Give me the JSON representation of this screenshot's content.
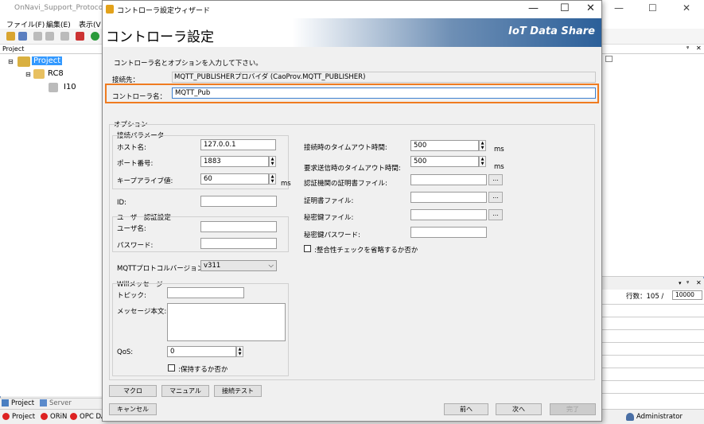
{
  "bg": {
    "title": "OnNavi_Support_Protocol_M",
    "menus": [
      "ファイル(F)",
      "編集(E)",
      "表示(V"
    ],
    "project_header": "Project",
    "tree": {
      "root": "Project",
      "child": "RC8",
      "leaf": "I10"
    },
    "bottom_tabs": [
      "Project",
      "Server"
    ],
    "status_items": [
      "Project",
      "ORiN",
      "OPC DA"
    ],
    "right_panel": {
      "rows_label": "行数：105 /",
      "rows_max": "10000",
      "user": "Administrator"
    }
  },
  "dialog": {
    "title": "コントローラ設定ウィザード",
    "heading": "コントローラ設定",
    "logo": "IoT Data Share",
    "instruction": "コントローラ名とオプションを入力して下さい。",
    "dest_label": "接続先：",
    "dest_value": "MQTT_PUBLISHERプロバイダ (CaoProv.MQTT_PUBLISHER)",
    "name_label": "コントローラ名：",
    "name_value": "MQTT_Pub",
    "options_label": "オプション",
    "conn_group": "接続パラメータ",
    "host_label": "ホスト名:",
    "host_value": "127.0.0.1",
    "port_label": "ポート番号:",
    "port_value": "1883",
    "keepalive_label": "キープアライブ値:",
    "keepalive_value": "60",
    "ms": "ms",
    "id_label": "ID:",
    "user_group": "ユーザー認証設定",
    "user_label": "ユーザ名:",
    "pass_label": "パスワード:",
    "mqtt_ver_label": "MQTTプロトコルバージョン:",
    "mqtt_ver_value": "v311",
    "will_group": "Willメッセージ",
    "topic_label": "トピック:",
    "body_label": "メッセージ本文:",
    "qos_label": "QoS:",
    "qos_value": "0",
    "retain_label": ":保持するか否か",
    "conn_timeout_label": "接続時のタイムアウト時間:",
    "conn_timeout_value": "500",
    "req_timeout_label": "要求送信時のタイムアウト時間:",
    "req_timeout_value": "500",
    "ca_label": "認証機関の証明書ファイル:",
    "cert_label": "証明書ファイル:",
    "key_label": "秘密鍵ファイル:",
    "key_pass_label": "秘密鍵パスワード:",
    "skip_check_label": ":整合性チェックを省略するか否か",
    "dots": "...",
    "buttons": {
      "macro": "マクロ",
      "manual": "マニュアル",
      "conn_test": "接続テスト",
      "cancel": "キャンセル",
      "back": "前へ",
      "next": "次へ",
      "finish": "完了"
    }
  }
}
